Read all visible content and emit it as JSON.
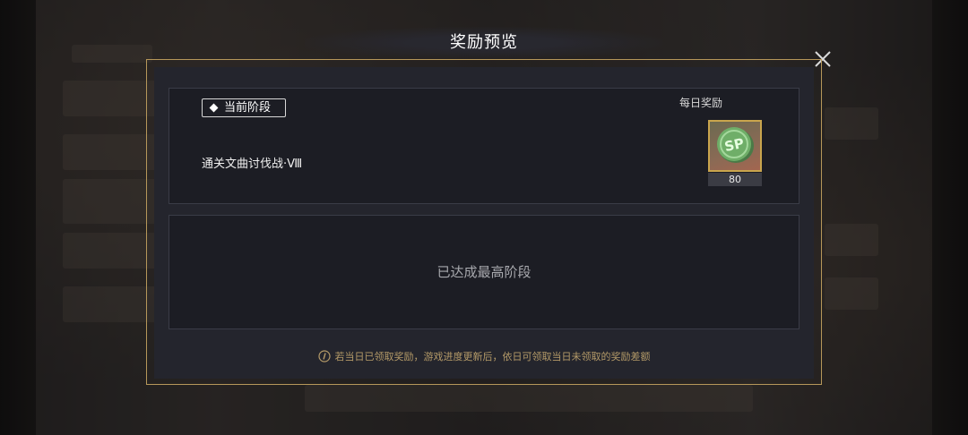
{
  "dialog": {
    "title": "奖励预览",
    "close_icon": "close-icon"
  },
  "current_stage": {
    "tag_label": "当前阶段",
    "stage_name": "通关文曲讨伐战·Ⅷ",
    "daily_reward_label": "每日奖励",
    "reward": {
      "icon": "sp-coin-icon",
      "icon_text": "SP",
      "count": "80"
    }
  },
  "next_stage": {
    "message": "已达成最高阶段"
  },
  "notice": {
    "icon": "info-icon",
    "text": "若当日已领取奖励，游戏进度更新后，依日可领取当日未领取的奖励差额"
  },
  "colors": {
    "accent_gold": "#c9a54d",
    "frame_gold": "#b6975a",
    "notice_text": "#b49a68",
    "coin_green": "#5e9d5c"
  }
}
